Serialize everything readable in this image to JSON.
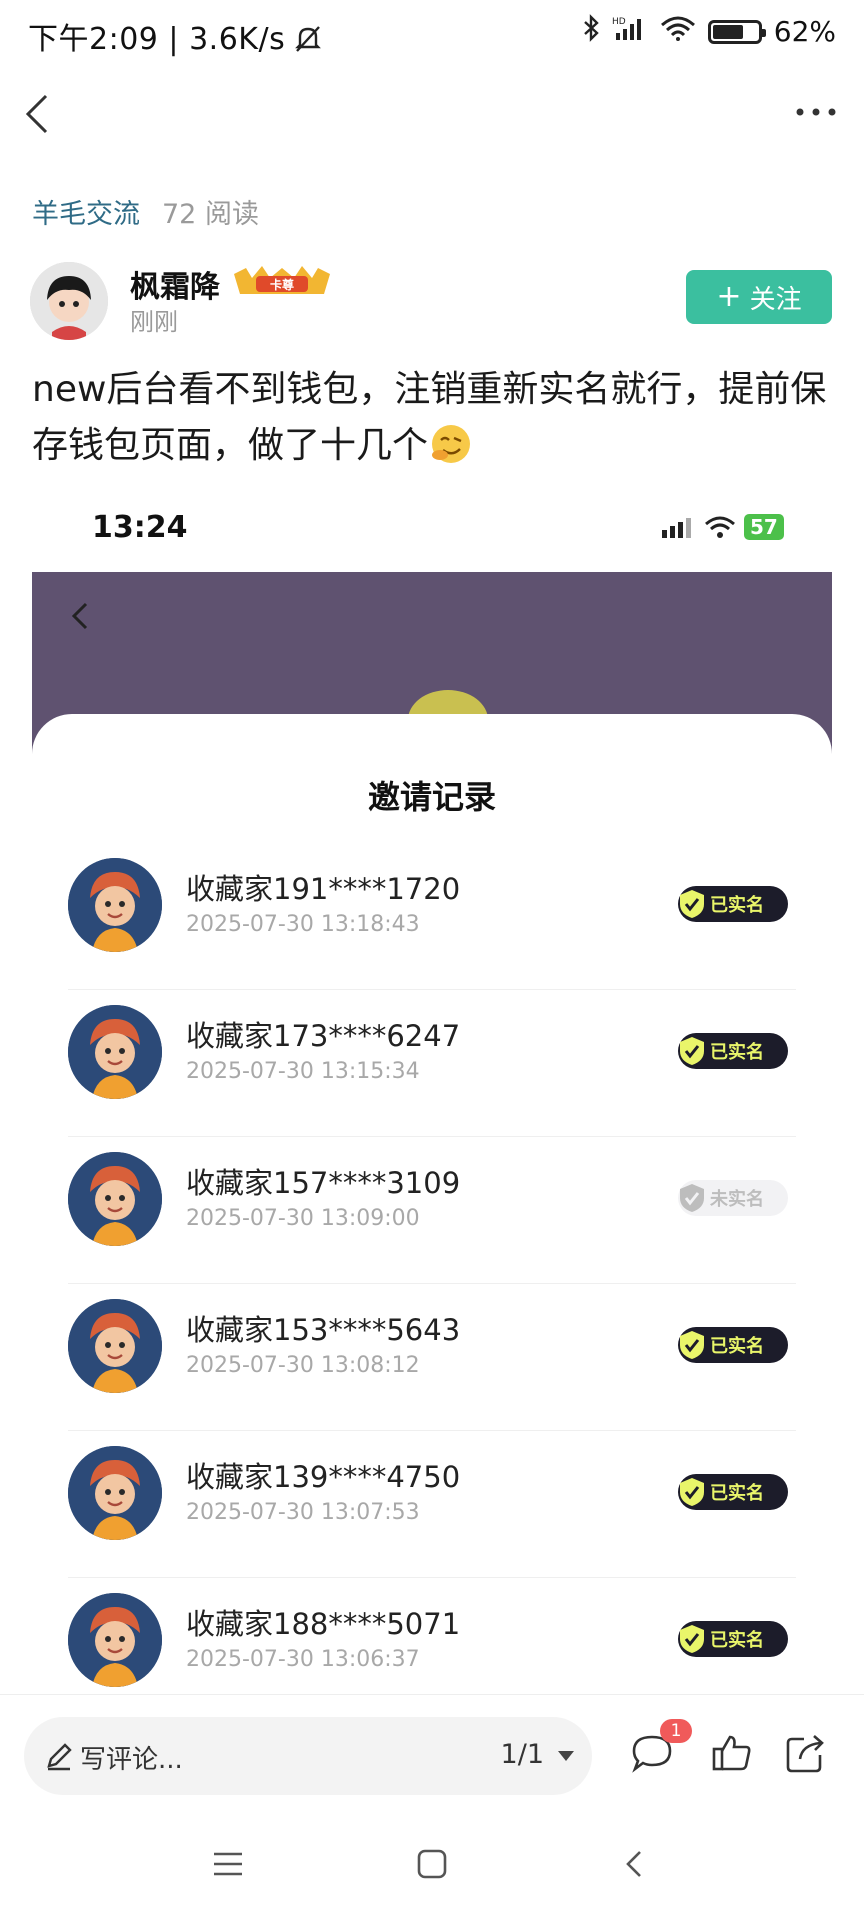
{
  "status_bar": {
    "time": "下午2:09",
    "speed": "3.6K/s",
    "battery": "62%",
    "battery_level": 0.62
  },
  "topic": {
    "name": "羊毛交流",
    "reads": "72 阅读"
  },
  "author": {
    "name": "枫霜降",
    "badge": "卡尊",
    "time": "刚刚",
    "follow_label": "关注"
  },
  "post": {
    "text": "new后台看不到钱包，注销重新实名就行，提前保存钱包页面，做了十几个"
  },
  "embedded": {
    "time": "13:24",
    "battery": "57",
    "title": "邀请记录",
    "records": [
      {
        "name": "收藏家191****1720",
        "time": "2025-07-30 13:18:43",
        "status": "已实名",
        "verified": true
      },
      {
        "name": "收藏家173****6247",
        "time": "2025-07-30 13:15:34",
        "status": "已实名",
        "verified": true
      },
      {
        "name": "收藏家157****3109",
        "time": "2025-07-30 13:09:00",
        "status": "未实名",
        "verified": false
      },
      {
        "name": "收藏家153****5643",
        "time": "2025-07-30 13:08:12",
        "status": "已实名",
        "verified": true
      },
      {
        "name": "收藏家139****4750",
        "time": "2025-07-30 13:07:53",
        "status": "已实名",
        "verified": true
      },
      {
        "name": "收藏家188****5071",
        "time": "2025-07-30 13:06:37",
        "status": "已实名",
        "verified": true
      }
    ]
  },
  "bottom_bar": {
    "comment_placeholder": "写评论...",
    "page": "1/1",
    "comment_badge": "1"
  },
  "colors": {
    "accent": "#3bbf9f",
    "topic": "#2f6b86",
    "banner": "#5f5270",
    "tag_bg": "#1c1c2a",
    "tag_text": "#e9f56a"
  }
}
